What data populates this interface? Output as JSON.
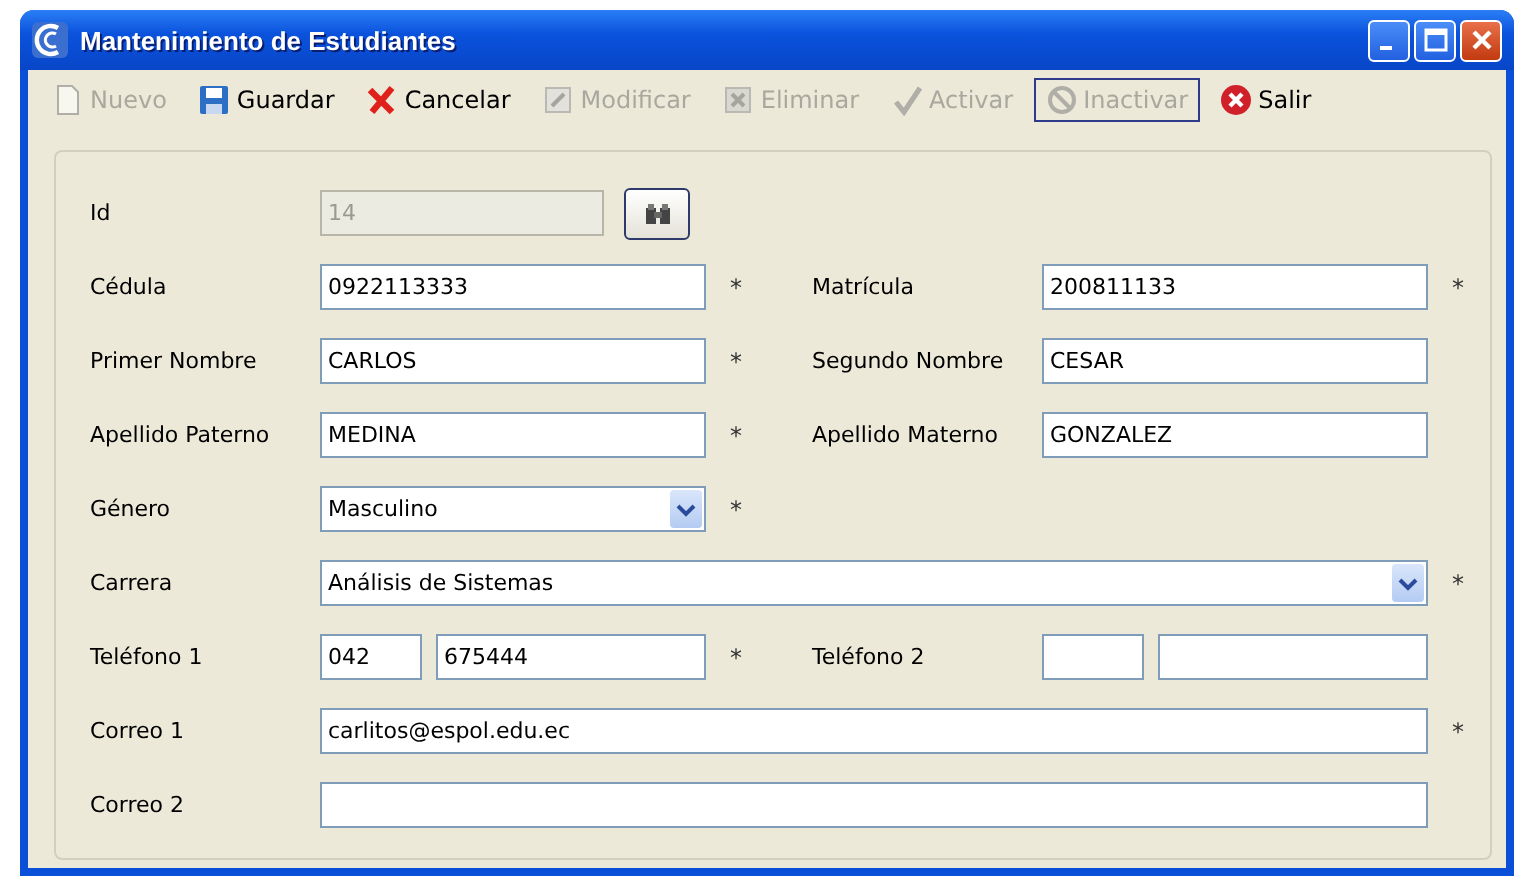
{
  "window": {
    "title": "Mantenimiento de Estudiantes"
  },
  "toolbar": [
    {
      "kind": "new",
      "label": "Nuevo",
      "disabled": true,
      "focused": false
    },
    {
      "kind": "save",
      "label": "Guardar",
      "disabled": false,
      "focused": false
    },
    {
      "kind": "cancel",
      "label": "Cancelar",
      "disabled": false,
      "focused": false
    },
    {
      "kind": "edit",
      "label": "Modificar",
      "disabled": true,
      "focused": false
    },
    {
      "kind": "delete",
      "label": "Eliminar",
      "disabled": true,
      "focused": false
    },
    {
      "kind": "activate",
      "label": "Activar",
      "disabled": true,
      "focused": false
    },
    {
      "kind": "deactivate",
      "label": "Inactivar",
      "disabled": true,
      "focused": true
    },
    {
      "kind": "exit",
      "label": "Salir",
      "disabled": false,
      "focused": false
    }
  ],
  "form": {
    "id": {
      "label": "Id",
      "value": "14",
      "disabled": true
    },
    "rows": [
      {
        "left": {
          "label": "Cédula",
          "kind": "text",
          "value": "0922113333",
          "required_mark": "*"
        },
        "right": {
          "label": "Matrícula",
          "kind": "text",
          "value": "200811133",
          "required_mark": "*"
        }
      },
      {
        "left": {
          "label": "Primer Nombre",
          "kind": "text",
          "value": "CARLOS",
          "required_mark": "*"
        },
        "right": {
          "label": "Segundo Nombre",
          "kind": "text",
          "value": "CESAR"
        }
      },
      {
        "left": {
          "label": "Apellido Paterno",
          "kind": "text",
          "value": "MEDINA",
          "required_mark": "*"
        },
        "right": {
          "label": "Apellido Materno",
          "kind": "text",
          "value": "GONZALEZ"
        }
      },
      {
        "left": {
          "label": "Género",
          "kind": "combo",
          "value": "Masculino",
          "required_mark": "*"
        }
      }
    ],
    "carrera": {
      "label": "Carrera",
      "kind": "combo",
      "value": "Análisis de Sistemas",
      "required_mark": "*"
    },
    "phones": [
      {
        "label": "Teléfono 1",
        "required_mark": "*",
        "parts": [
          {
            "kind": "area",
            "value": "042"
          },
          {
            "kind": "number",
            "value": "675444"
          }
        ]
      },
      {
        "label": "Teléfono 2",
        "parts": [
          {
            "kind": "area"
          },
          {
            "kind": "number"
          }
        ]
      }
    ],
    "emails": [
      {
        "label": "Correo 1",
        "value": "carlitos@espol.edu.ec",
        "required_mark": "*"
      },
      {
        "label": "Correo 2"
      }
    ]
  }
}
